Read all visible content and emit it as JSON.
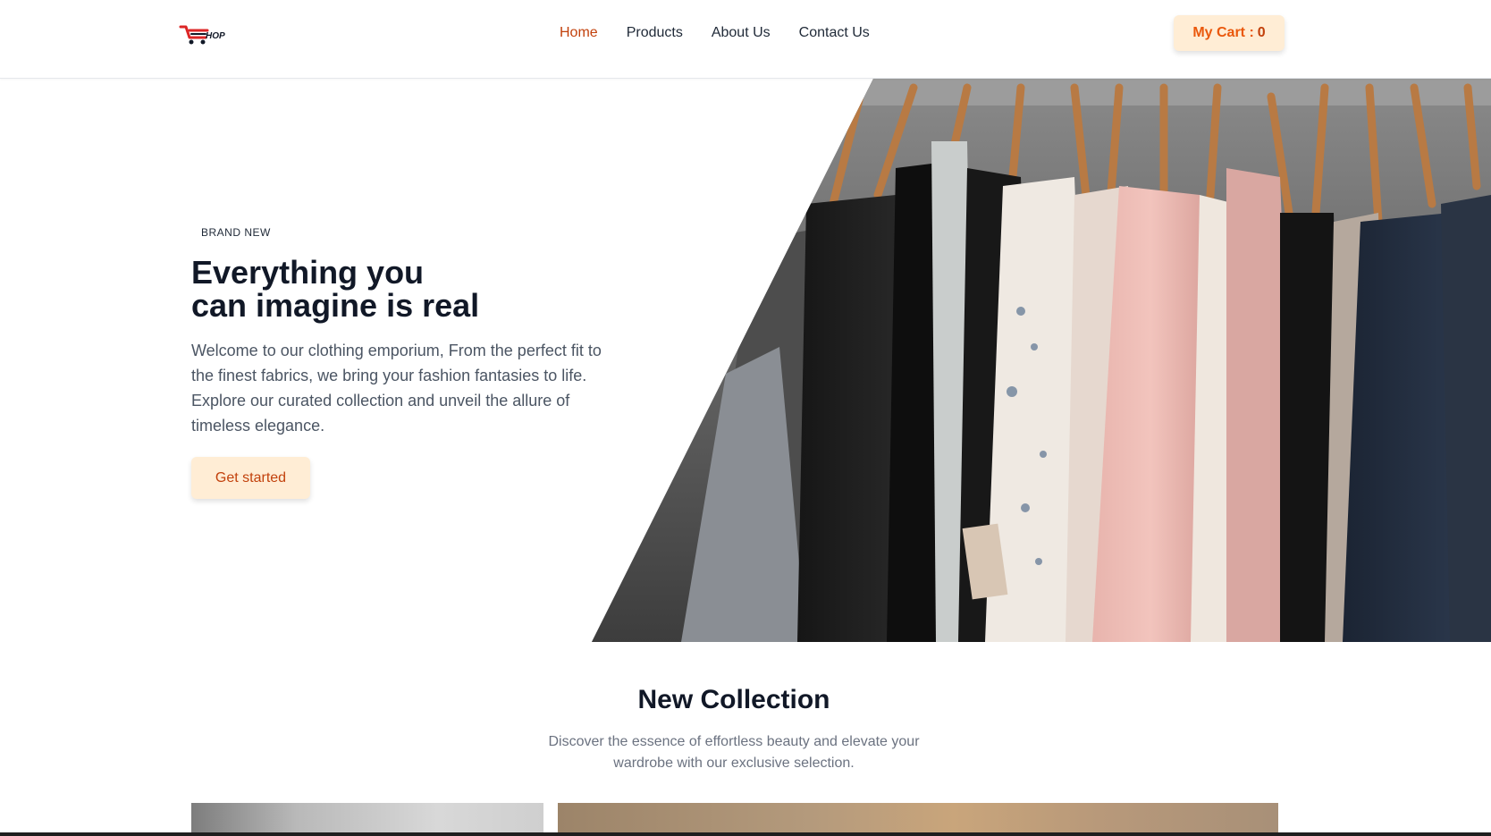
{
  "header": {
    "logo_text": "HOP",
    "nav": [
      {
        "label": "Home",
        "active": true
      },
      {
        "label": "Products",
        "active": false
      },
      {
        "label": "About Us",
        "active": false
      },
      {
        "label": "Contact Us",
        "active": false
      }
    ],
    "cart_label": "My Cart :",
    "cart_count": "0"
  },
  "hero": {
    "tag": "BRAND NEW",
    "title_line1": "Everything you",
    "title_line2": "can imagine is real",
    "description": "Welcome to our clothing emporium, From the perfect fit to the finest fabrics, we bring your fashion fantasies to life. Explore our curated collection and unveil the allure of timeless elegance.",
    "cta_label": "Get started"
  },
  "collection": {
    "title": "New Collection",
    "subtitle": "Discover the essence of effortless beauty and elevate your wardrobe with our exclusive selection."
  },
  "colors": {
    "accent": "#c2410c",
    "button_bg": "#ffedd5",
    "cart_text": "#ea580c"
  },
  "icons": [
    "cart-logo-icon"
  ]
}
